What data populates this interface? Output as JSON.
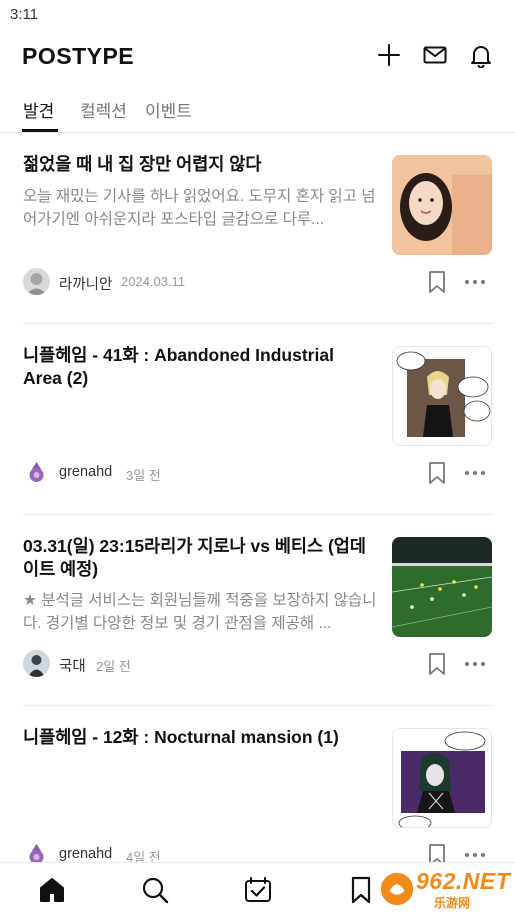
{
  "status_bar": {
    "time": "3:11"
  },
  "header": {
    "logo": "POSTYPE",
    "icons": [
      "plus-icon",
      "mail-icon",
      "bell-icon"
    ]
  },
  "tabs": [
    {
      "label": "발견",
      "active": true
    },
    {
      "label": "컬렉션",
      "active": false
    },
    {
      "label": "이벤트",
      "active": false
    }
  ],
  "posts": [
    {
      "title": "젊었을 때 내 집 장만 어렵지 않다",
      "excerpt": "오늘 재밌는 기사를 하나 읽었어요.  도무지 혼자 읽고 넘어가기엔 아쉬운지라 포스타입 글감으로 다루...",
      "author": "라까니안",
      "date": "2024.03.11",
      "thumbnail": "portrait-photo"
    },
    {
      "title": "니플헤임 - 41화 : Abandoned Industrial Area (2)",
      "excerpt": "",
      "author": "grenahd",
      "date": "3일 전",
      "thumbnail": "comic-panel"
    },
    {
      "title": "03.31(일) 23:15라리가 지로나 vs 베티스 (업데이트 예정)",
      "excerpt": "★ 분석글 서비스는 회원님들께 적중을 보장하지 않습니다. 경기별 다양한 정보 및 경기 관점을 제공해 ...",
      "author": "국대",
      "date": "2일 전",
      "thumbnail": "soccer-field"
    },
    {
      "title": "니플헤임 - 12화 : Nocturnal mansion (1)",
      "excerpt": "",
      "author": "grenahd",
      "date": "4일 전",
      "thumbnail": "comic-panel"
    }
  ],
  "bottom_nav": [
    {
      "name": "home-icon",
      "active": true
    },
    {
      "name": "search-icon",
      "active": false
    },
    {
      "name": "feed-icon",
      "active": false
    },
    {
      "name": "bookmark-icon",
      "active": false
    }
  ],
  "watermark": {
    "text": "962.NET",
    "sub": "乐游网"
  },
  "colors": {
    "accent": "#111111",
    "muted_text": "#888888",
    "divider": "#ececec",
    "watermark": "#f28a1a"
  }
}
